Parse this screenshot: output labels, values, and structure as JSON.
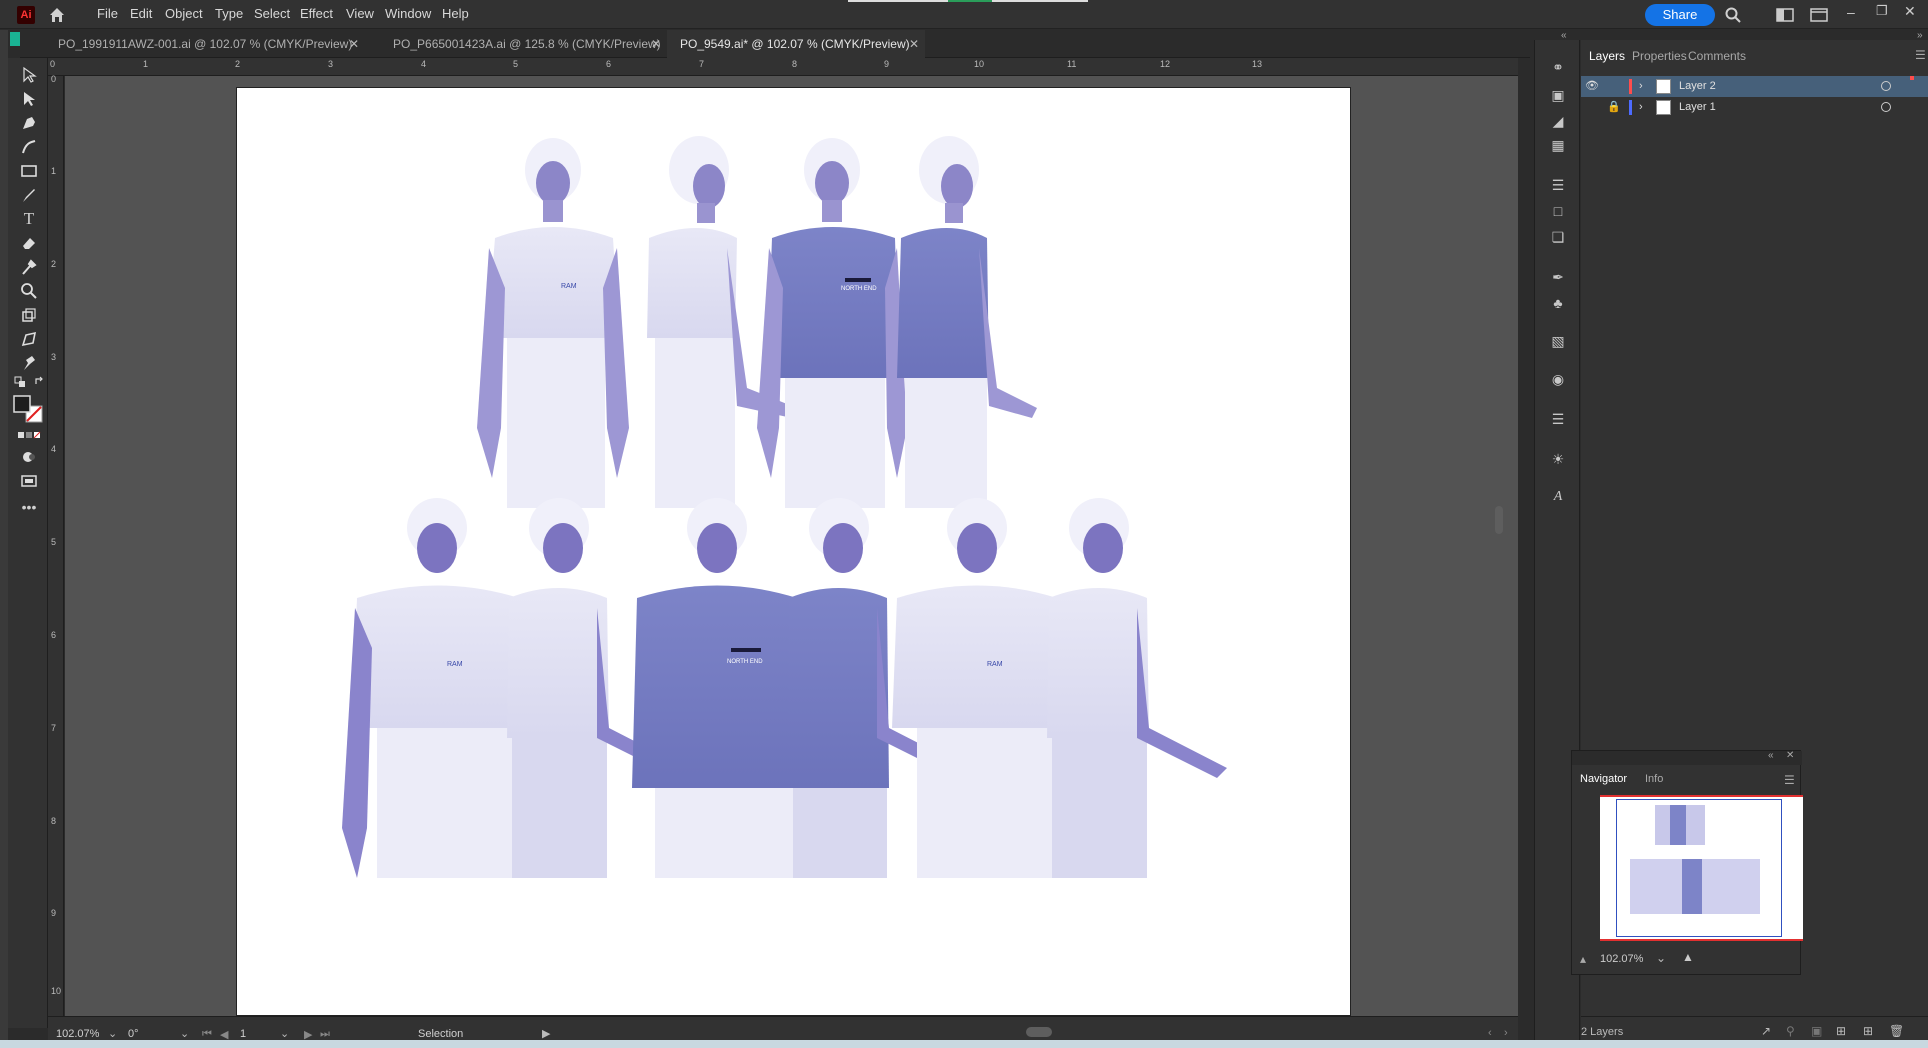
{
  "app": {
    "logo": "Ai",
    "menu": [
      "File",
      "Edit",
      "Object",
      "Type",
      "Select",
      "Effect",
      "View",
      "Window",
      "Help"
    ],
    "share_label": "Share",
    "accent": "#1473e6"
  },
  "tabs": [
    {
      "label": "PO_1991911AWZ-001.ai @ 102.07 % (CMYK/Preview)",
      "active": false
    },
    {
      "label": "PO_P665001423A.ai @ 125.8 % (CMYK/Preview)",
      "active": false
    },
    {
      "label": "PO_9549.ai* @ 102.07 % (CMYK/Preview)",
      "active": true
    }
  ],
  "ruler": {
    "top_labels": [
      "0",
      "1",
      "2",
      "3",
      "4",
      "5",
      "6",
      "7",
      "8",
      "9",
      "10",
      "11",
      "12",
      "13"
    ],
    "left_labels": [
      "0",
      "1",
      "2",
      "3",
      "4",
      "5",
      "6",
      "7",
      "8",
      "9",
      "10"
    ]
  },
  "statusbar": {
    "zoom": "102.07%",
    "rotation": "0°",
    "artboard_number": "1",
    "tool_name": "Selection"
  },
  "panel": {
    "tabs": [
      "Layers",
      "Properties",
      "Comments"
    ],
    "layers": [
      {
        "name": "Layer 2",
        "color": "#ff4d4d",
        "selected": true,
        "locked": false
      },
      {
        "name": "Layer 1",
        "color": "#4d6bff",
        "selected": false,
        "locked": true
      }
    ],
    "layer_count": "2 Layers"
  },
  "navigator": {
    "tabs": [
      "Navigator",
      "Info"
    ],
    "zoom": "102.07%"
  },
  "artwork": {
    "logo_text_1": "NORTH END",
    "logo_text_2": "RAM"
  }
}
